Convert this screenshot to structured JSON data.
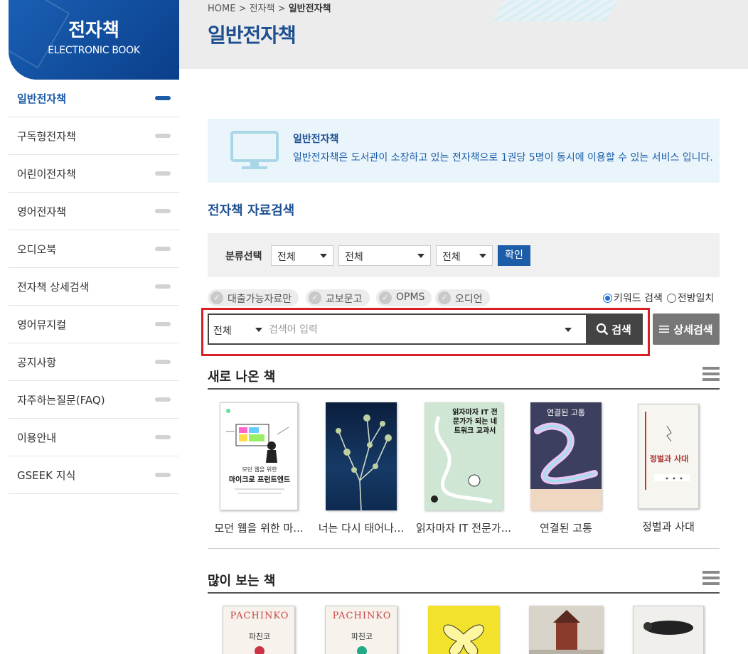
{
  "sidebar": {
    "title": "전자책",
    "subtitle": "ELECTRONIC BOOK",
    "items": [
      {
        "label": "일반전자책"
      },
      {
        "label": "구독형전자책"
      },
      {
        "label": "어린이전자책"
      },
      {
        "label": "영어전자책"
      },
      {
        "label": "오디오북"
      },
      {
        "label": "전자책 상세검색"
      },
      {
        "label": "영어뮤지컬"
      },
      {
        "label": "공지사항"
      },
      {
        "label": "자주하는질문(FAQ)"
      },
      {
        "label": "이용안내"
      },
      {
        "label": "GSEEK 지식"
      }
    ]
  },
  "breadcrumb": {
    "home": "HOME",
    "sep": ">",
    "level1": "전자책",
    "current": "일반전자책"
  },
  "page_title": "일반전자책",
  "info": {
    "title": "일반전자책",
    "description": "일반전자책은 도서관이 소장하고 있는 전자책으로 1권당 5명이 동시에 이용할 수 있는 서비스 입니다."
  },
  "search_section": {
    "title": "전자책 자료검색",
    "category_label": "분류선택",
    "selects": [
      "전체",
      "전체",
      "전체"
    ],
    "confirm": "확인",
    "filters": [
      "대출가능자료만",
      "교보문고",
      "OPMS",
      "오디언"
    ],
    "radios": [
      {
        "label": "키워드 검색",
        "checked": true
      },
      {
        "label": "전방일치",
        "checked": false
      }
    ],
    "scope": "전체",
    "placeholder": "검색어 입력",
    "search_button": "검색",
    "detail_button": "상세검색"
  },
  "new_books": {
    "title": "새로 나온 책",
    "items": [
      {
        "title": "모던 웹을 위한 마..."
      },
      {
        "title": "너는 다시 태어나..."
      },
      {
        "title": "읽자마자 IT 전문가..."
      },
      {
        "title": "연결된 고통"
      },
      {
        "title": "정벌과 사대"
      }
    ]
  },
  "popular_books": {
    "title": "많이 보는 책"
  },
  "cover_text": {
    "b1_title": "마이크로 프런트엔드",
    "b1_sub": "모던 웹을 위한",
    "b3_title": "읽자마자 IT 전문가가 되는 네트워크 교과서",
    "b4_title": "연결된 고통",
    "b5_title": "정벌과 사대",
    "p1_title": "PACHINKO",
    "p1_kr": "파친코",
    "p2_title": "PACHINKO",
    "p2_kr": "파친코"
  }
}
